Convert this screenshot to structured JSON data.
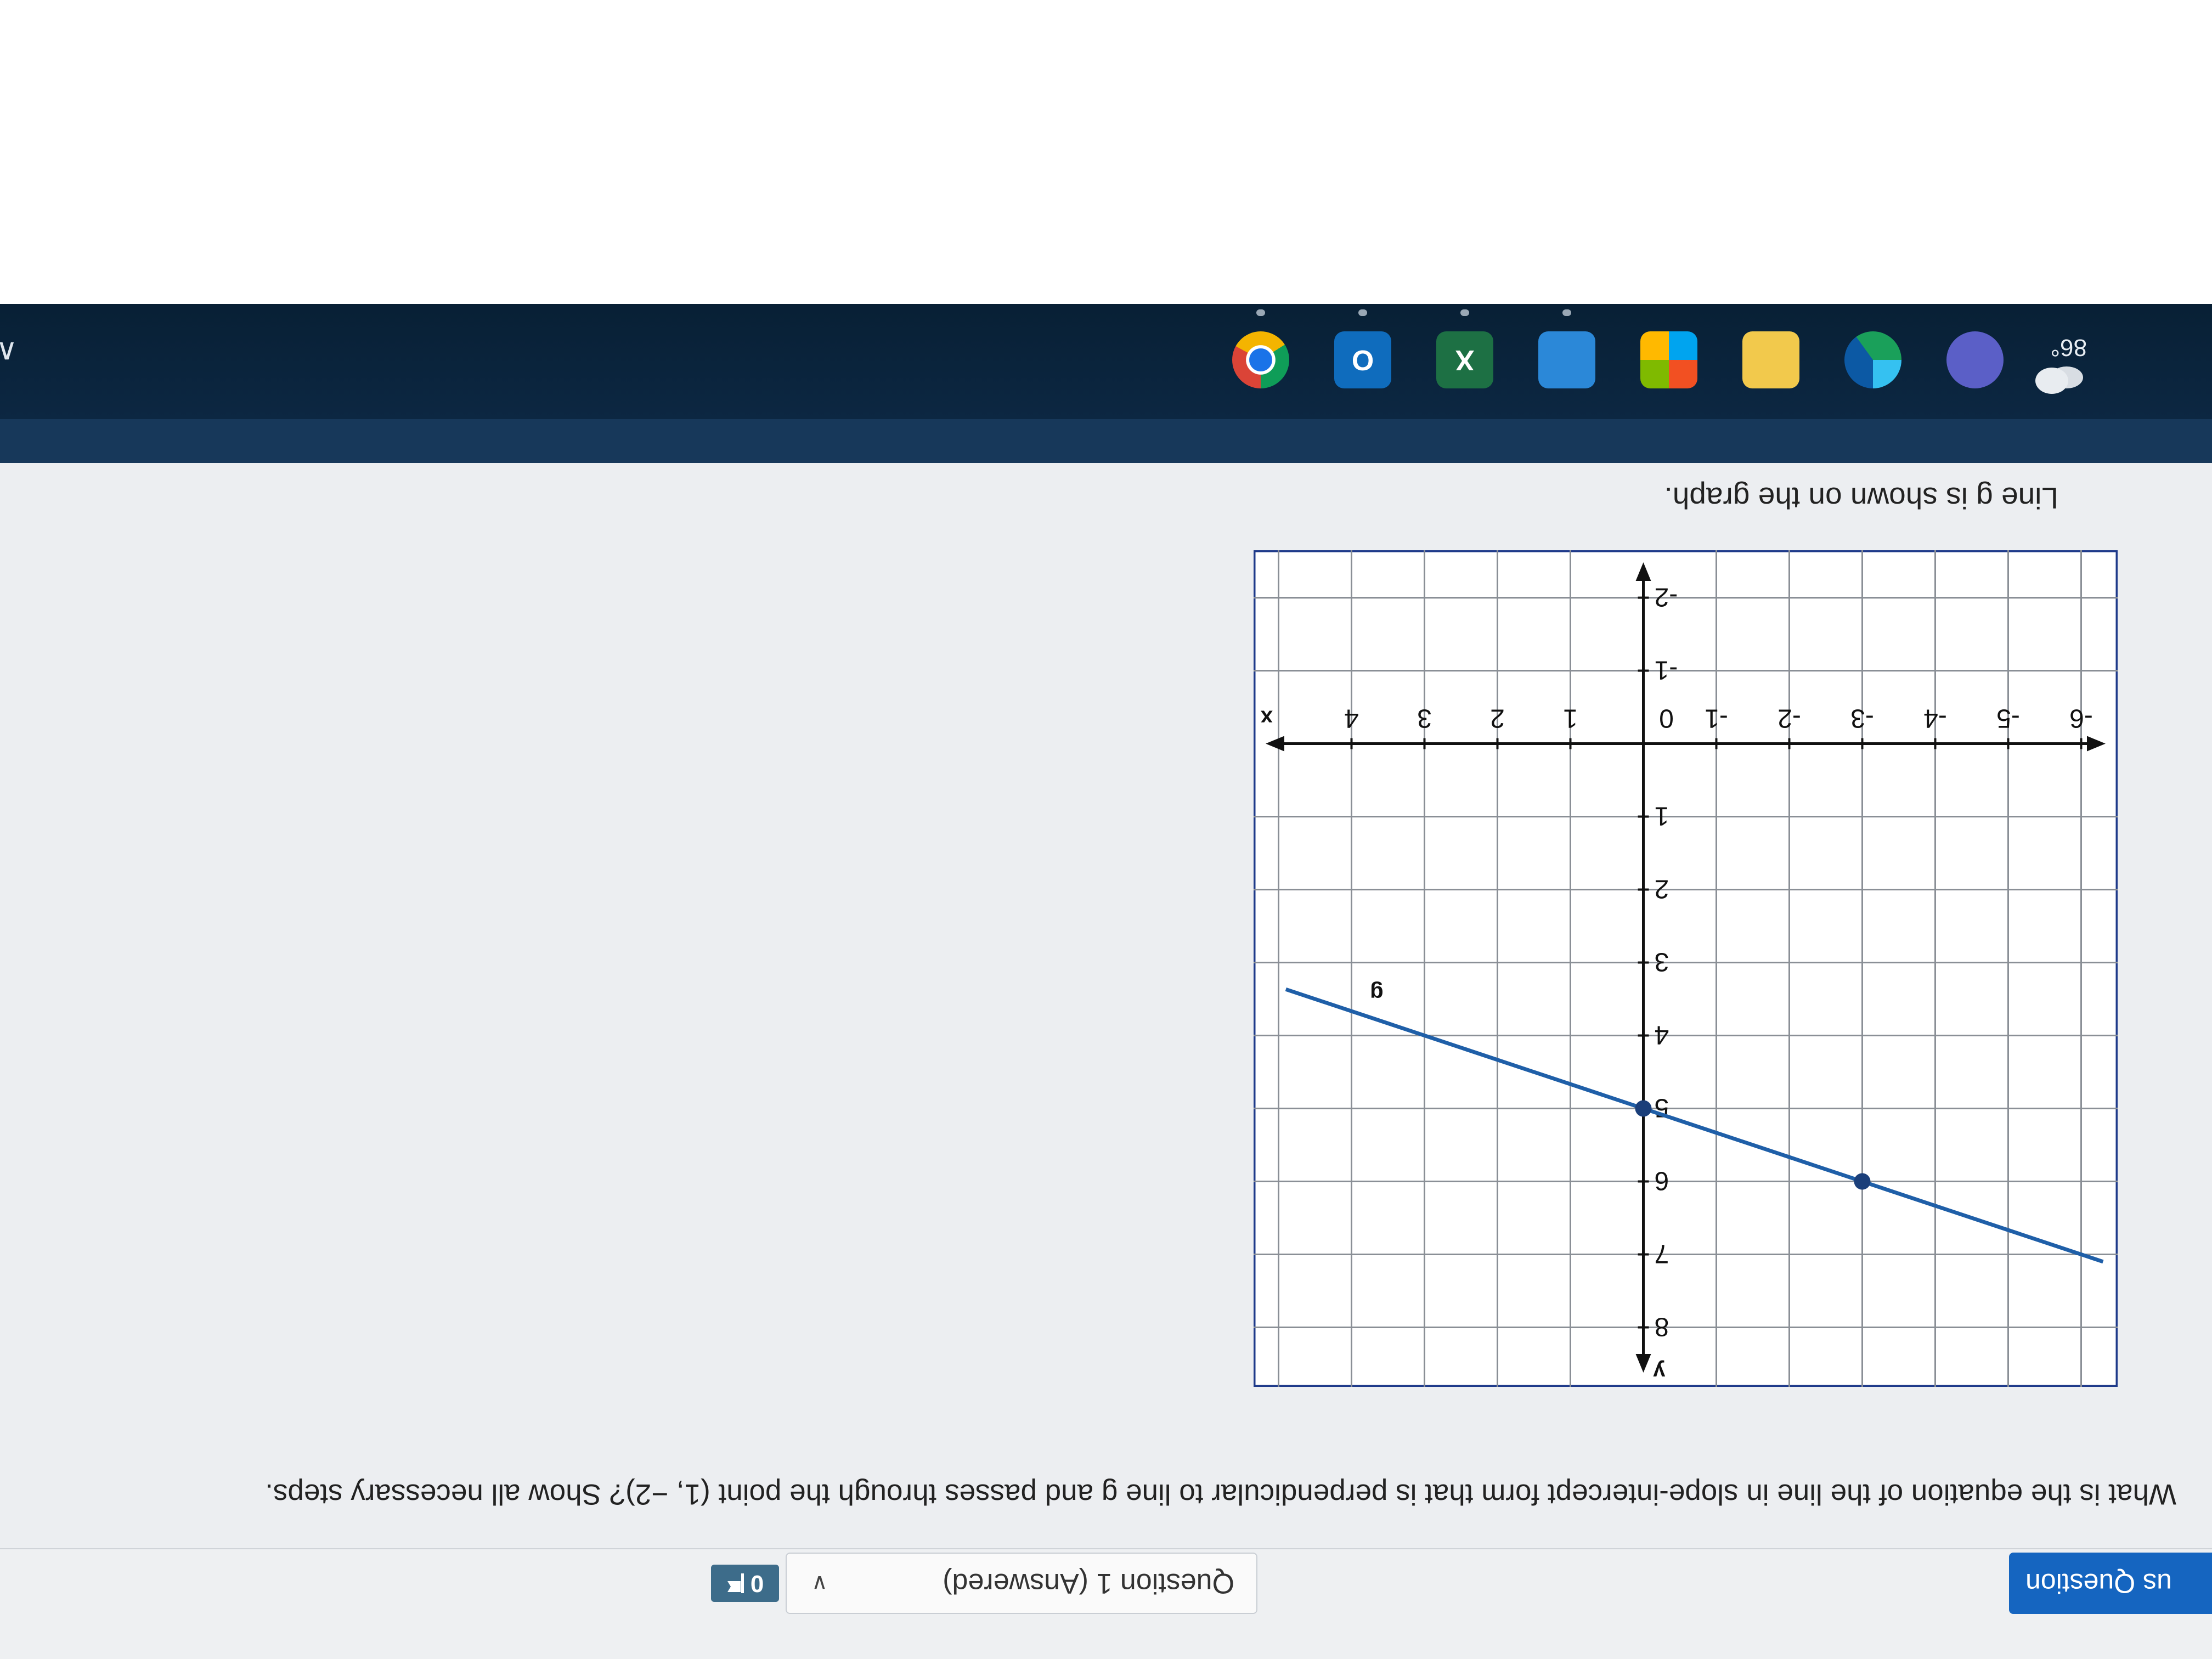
{
  "quiz": {
    "intro": "Line g is shown on the graph.",
    "question": "What is the equation of the line in slope-intercept form that is perpendicular to line g and passes through the point (1, −2)? Show all necessary steps.",
    "prev_button": "us Question",
    "question_selector": "Question 1 (Answered)",
    "flag_count": "0"
  },
  "chart_data": {
    "type": "line",
    "xlabel": "x",
    "ylabel": "y",
    "xlim": [
      -6.5,
      5.0
    ],
    "ylim": [
      -2.5,
      9.0
    ],
    "x_ticks": [
      -6,
      -5,
      -4,
      -3,
      -2,
      -1,
      0,
      1,
      2,
      3,
      4
    ],
    "y_ticks": [
      -2,
      -1,
      1,
      2,
      3,
      4,
      5,
      6,
      7,
      8
    ],
    "grid": true,
    "series": [
      {
        "name": "g",
        "points": [
          [
            -3,
            6
          ],
          [
            0,
            5
          ]
        ],
        "line_x_range": [
          -6.3,
          4.9
        ],
        "color": "#1f5fa8"
      }
    ]
  },
  "taskbar": {
    "weather_temp": "86°",
    "apps": [
      {
        "icon": "chrome-icon",
        "color": "#f4b400"
      },
      {
        "icon": "outlook-icon",
        "color": "#0f6cbd",
        "glyph": "O"
      },
      {
        "icon": "excel-icon",
        "color": "#1d7044",
        "glyph": "X"
      },
      {
        "icon": "mail-icon",
        "color": "#2b88d8"
      },
      {
        "icon": "store-icon",
        "color": "#e6e6e6"
      },
      {
        "icon": "file-explorer-icon",
        "color": "#f2c94c"
      },
      {
        "icon": "edge-icon",
        "color": "#1aa05a"
      },
      {
        "icon": "teams-icon",
        "color": "#5b5fc7"
      }
    ]
  }
}
